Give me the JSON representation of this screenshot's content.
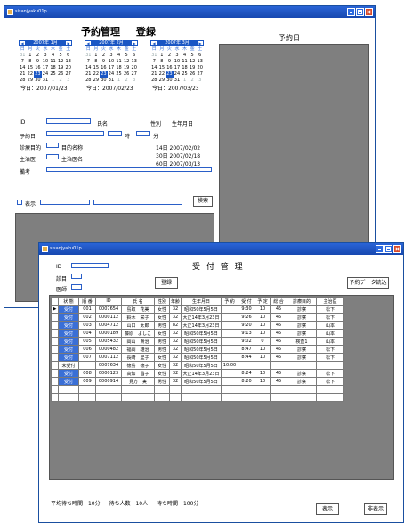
{
  "win1": {
    "title": "sisanjyaku01p",
    "heading_left": "予約管理",
    "heading_right": "登録",
    "right_label": "予約日",
    "calendars": [
      {
        "month": "2007年 1月",
        "today": "今日：2007/01/23",
        "dow": [
          "日",
          "月",
          "火",
          "水",
          "木",
          "金",
          "土"
        ],
        "days": [
          [
            "31",
            "1",
            "2",
            "3",
            "4",
            "5",
            "6"
          ],
          [
            "7",
            "8",
            "9",
            "10",
            "11",
            "12",
            "13"
          ],
          [
            "14",
            "15",
            "16",
            "17",
            "18",
            "19",
            "20"
          ],
          [
            "21",
            "22",
            "23",
            "24",
            "25",
            "26",
            "27"
          ],
          [
            "28",
            "29",
            "30",
            "31",
            "1",
            "2",
            "3"
          ]
        ],
        "sel": "23"
      },
      {
        "month": "2007年 2月",
        "today": "今日：2007/02/23",
        "dow": [
          "日",
          "月",
          "火",
          "水",
          "木",
          "金",
          "土"
        ],
        "days": [
          [
            "31",
            "1",
            "2",
            "3",
            "4",
            "5",
            "6"
          ],
          [
            "7",
            "8",
            "9",
            "10",
            "11",
            "12",
            "13"
          ],
          [
            "14",
            "15",
            "16",
            "17",
            "18",
            "19",
            "20"
          ],
          [
            "21",
            "22",
            "23",
            "24",
            "25",
            "26",
            "27"
          ],
          [
            "28",
            "29",
            "30",
            "31",
            "1",
            "2",
            "3"
          ]
        ],
        "sel": "23"
      },
      {
        "month": "2007年 3月",
        "today": "今日：2007/03/23",
        "dow": [
          "日",
          "月",
          "火",
          "水",
          "木",
          "金",
          "土"
        ],
        "days": [
          [
            "31",
            "1",
            "2",
            "3",
            "4",
            "5",
            "6"
          ],
          [
            "7",
            "8",
            "9",
            "10",
            "11",
            "12",
            "13"
          ],
          [
            "14",
            "15",
            "16",
            "17",
            "18",
            "19",
            "20"
          ],
          [
            "21",
            "22",
            "23",
            "24",
            "25",
            "26",
            "27"
          ],
          [
            "28",
            "29",
            "30",
            "31",
            "1",
            "2",
            "3"
          ]
        ],
        "sel": "23"
      }
    ],
    "form": {
      "id_label": "ID",
      "name_label": "氏名",
      "sex_label": "性別",
      "birth_label": "生年月日",
      "date_label": "予約日",
      "hour_label": "時",
      "min_label": "分",
      "purpose_label": "診療目的",
      "purpose_name_label": "目的名称",
      "doctor_label": "主治医",
      "doctor_name_label": "主治医名",
      "note_label": "備考",
      "d14": "14日 2007/02/02",
      "d30": "30日 2007/02/18",
      "d60": "60日 2007/03/13",
      "show_label": "表示",
      "search_button": "検索"
    }
  },
  "win2": {
    "title": "sisanjyaku01p",
    "heading": "受 付 管 理",
    "id_label": "ID",
    "purpose_label": "診目",
    "doctor_label": "医師",
    "register_button": "登録",
    "load_button": "予約データ読込",
    "columns": [
      "状 態",
      "順 番",
      "ID",
      "氏 名",
      "性別",
      "年齢",
      "生年月日",
      "予 約",
      "受 付",
      "予 定",
      "総 合",
      "診療目的",
      "主治医"
    ],
    "rows": [
      {
        "st": "受付",
        "no": "001",
        "id": "0007654",
        "name": "島取　花美",
        "sex": "女性",
        "age": "32",
        "birth": "昭和50年5月5日",
        "res": "",
        "rec": "9:30",
        "plan": "10",
        "total": "45",
        "purpose": "診察",
        "doctor": "松下"
      },
      {
        "st": "受付",
        "no": "002",
        "id": "0000112",
        "name": "鈴木　栄子",
        "sex": "女性",
        "age": "32",
        "birth": "大正14年3月23日",
        "res": "",
        "rec": "9:26",
        "plan": "10",
        "total": "45",
        "purpose": "診察",
        "doctor": "松下"
      },
      {
        "st": "受付",
        "no": "003",
        "id": "0004712",
        "name": "山口　太郎",
        "sex": "男性",
        "age": "82",
        "birth": "大正14年3月23日",
        "res": "",
        "rec": "9:20",
        "plan": "10",
        "total": "45",
        "purpose": "診察",
        "doctor": "山本"
      },
      {
        "st": "受付",
        "no": "004",
        "id": "0000189",
        "name": "藤原　よしこ",
        "sex": "女性",
        "age": "32",
        "birth": "昭和50年5月5日",
        "res": "",
        "rec": "9:13",
        "plan": "10",
        "total": "45",
        "purpose": "診察",
        "doctor": "山本"
      },
      {
        "st": "受付",
        "no": "005",
        "id": "0005432",
        "name": "岡山　賢治",
        "sex": "男性",
        "age": "32",
        "birth": "昭和50年5月5日",
        "res": "",
        "rec": "9:02",
        "plan": "0",
        "total": "45",
        "purpose": "検査1",
        "doctor": "山本"
      },
      {
        "st": "受付",
        "no": "006",
        "id": "0000482",
        "name": "福岡　雄治",
        "sex": "男性",
        "age": "32",
        "birth": "昭和50年5月5日",
        "res": "",
        "rec": "8:47",
        "plan": "10",
        "total": "45",
        "purpose": "診察",
        "doctor": "松下"
      },
      {
        "st": "受付",
        "no": "007",
        "id": "0007112",
        "name": "長崎　里子",
        "sex": "女性",
        "age": "32",
        "birth": "昭和50年5月5日",
        "res": "",
        "rec": "8:44",
        "plan": "10",
        "total": "45",
        "purpose": "診察",
        "doctor": "松下"
      },
      {
        "st": "未受付",
        "no": "",
        "id": "0007634",
        "name": "徳島　徳子",
        "sex": "女性",
        "age": "32",
        "birth": "昭和50年5月5日",
        "res": "10:00",
        "rec": "",
        "plan": "",
        "total": "",
        "purpose": "",
        "doctor": ""
      },
      {
        "st": "受付",
        "no": "008",
        "id": "0000123",
        "name": "高知　昌子",
        "sex": "女性",
        "age": "32",
        "birth": "大正14年3月23日",
        "res": "",
        "rec": "8:24",
        "plan": "10",
        "total": "45",
        "purpose": "診察",
        "doctor": "松下"
      },
      {
        "st": "受付",
        "no": "009",
        "id": "0000914",
        "name": "見方　実",
        "sex": "男性",
        "age": "32",
        "birth": "昭和50年5月5日",
        "res": "",
        "rec": "8:20",
        "plan": "10",
        "total": "45",
        "purpose": "診察",
        "doctor": "松下"
      }
    ],
    "footer": {
      "wait_avg_label": "平均待ち時間",
      "wait_avg": "10分",
      "waiting_label": "待ち人数",
      "waiting": "10人",
      "wait_time_label": "待ち時間",
      "wait_time": "100分",
      "show_button": "表示",
      "hide_button": "非表示"
    }
  }
}
